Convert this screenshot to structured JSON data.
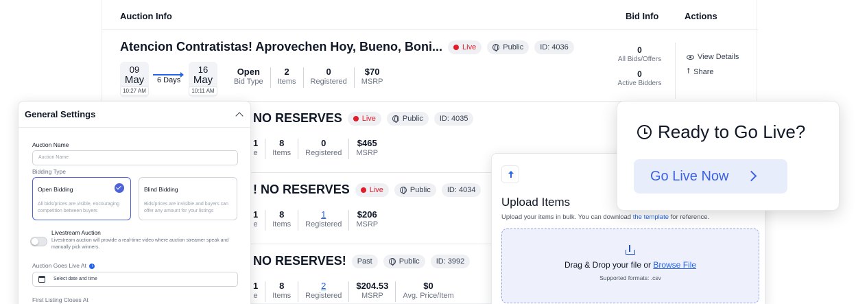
{
  "table": {
    "headers": {
      "auction_info": "Auction Info",
      "bid_info": "Bid Info",
      "actions": "Actions"
    },
    "first_row": {
      "title": "Atencion Contratistas! Aprovechen Hoy, Bueno, Boni...",
      "status": "Live",
      "visibility": "Public",
      "id": "ID: 4036",
      "start": {
        "day": "09",
        "month": "May",
        "time": "10:27 AM"
      },
      "end": {
        "day": "16",
        "month": "May",
        "time": "10:11 AM"
      },
      "duration": "6 Days",
      "stats": [
        {
          "value": "Open",
          "label": "Bid Type"
        },
        {
          "value": "2",
          "label": "Items"
        },
        {
          "value": "0",
          "label": "Registered"
        },
        {
          "value": "$70",
          "label": "MSRP"
        }
      ],
      "bids": {
        "value": "0",
        "label": "All Bids/Offers"
      },
      "bidders": {
        "value": "0",
        "label": "Active Bidders"
      },
      "actions": {
        "view": "View Details",
        "share": "Share"
      }
    },
    "row2": {
      "title": "NO RESERVES",
      "status": "Live",
      "visibility": "Public",
      "id": "ID: 4035",
      "partial_value": "1",
      "partial_label": "e",
      "stats": [
        {
          "value": "8",
          "label": "Items"
        },
        {
          "value": "0",
          "label": "Registered"
        },
        {
          "value": "$465",
          "label": "MSRP"
        }
      ]
    },
    "row3": {
      "title": "! NO RESERVES",
      "status": "Live",
      "visibility": "Public",
      "id": "ID: 4034",
      "partial_value": "1",
      "partial_label": "e",
      "stats": [
        {
          "value": "8",
          "label": "Items"
        },
        {
          "value": "1",
          "label": "Registered"
        },
        {
          "value": "$206",
          "label": "MSRP"
        }
      ]
    },
    "row4": {
      "title": "NO RESERVES!",
      "status": "Past",
      "visibility": "Public",
      "id": "ID: 3992",
      "partial_value": "1",
      "partial_label": "e",
      "stats": [
        {
          "value": "8",
          "label": "Items"
        },
        {
          "value": "2",
          "label": "Registered"
        },
        {
          "value": "$204.53",
          "label": "MSRP"
        },
        {
          "value": "$0",
          "label": "Avg. Price/Item"
        }
      ]
    }
  },
  "settings": {
    "title": "General Settings",
    "auction_name_label": "Auction Name",
    "auction_name_placeholder": "Auction Name",
    "bidding_type_label": "Bidding Type",
    "open_bidding": {
      "title": "Open Bidding",
      "desc": "All bids/prices are visible, encouraging competition between buyers"
    },
    "blind_bidding": {
      "title": "Blind Bidding",
      "desc": "Bids/prices are invisible and buyers can offer any amount for your listings"
    },
    "livestream": {
      "title": "Livestream Auction",
      "desc": "Livestream auction will provide a real-time video where auction streamer speak and manually pick winners."
    },
    "goes_live_label": "Auction Goes Live At",
    "date_placeholder": "Select date and time",
    "first_closes_label": "First Listing Closes At"
  },
  "upload": {
    "title": "Upload Items",
    "subtitle_prefix": "Upload your items in bulk. You can download ",
    "subtitle_link": "the template",
    "subtitle_suffix": " for reference.",
    "drop_prefix": "Drag & Drop your file or ",
    "drop_link": "Browse File",
    "formats": "Supported formats: .csv"
  },
  "ready": {
    "title": "Ready to Go Live?",
    "button": "Go Live Now"
  },
  "colors": {
    "accent": "#3b63e3",
    "live": "#e11d2a",
    "link": "#2563eb"
  }
}
